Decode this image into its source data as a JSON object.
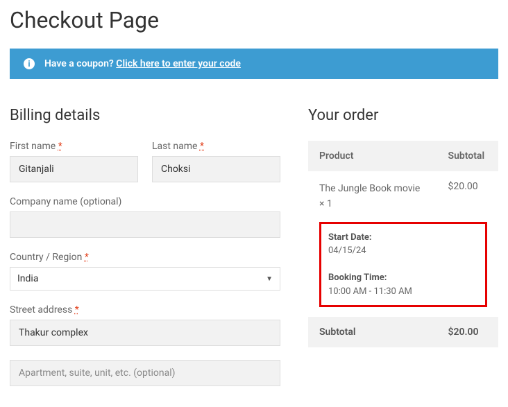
{
  "page": {
    "title": "Checkout Page"
  },
  "coupon": {
    "prompt": "Have a coupon? ",
    "link_text": "Click here to enter your code"
  },
  "billing": {
    "heading": "Billing details",
    "first_name_label": "First name",
    "first_name_value": "Gitanjali",
    "last_name_label": "Last name",
    "last_name_value": "Choksi",
    "company_label": "Company name (optional)",
    "company_value": "",
    "country_label": "Country / Region",
    "country_value": "India",
    "street_label": "Street address",
    "street_value": "Thakur complex",
    "apt_placeholder": "Apartment, suite, unit, etc. (optional)",
    "apt_value": ""
  },
  "order": {
    "heading": "Your order",
    "header_product": "Product",
    "header_subtotal": "Subtotal",
    "item": {
      "name": "The Jungle Book movie",
      "qty": "× 1",
      "price": "$20.00",
      "start_date_label": "Start Date:",
      "start_date_value": "04/15/24",
      "booking_time_label": "Booking Time:",
      "booking_time_value": "10:00 AM - 11:30 AM"
    },
    "subtotal_label": "Subtotal",
    "subtotal_value": "$20.00"
  },
  "required_mark": "*"
}
